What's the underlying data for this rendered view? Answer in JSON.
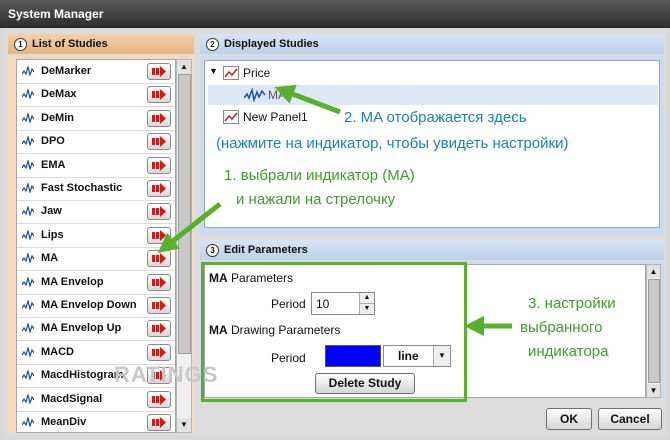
{
  "window": {
    "title": "System Manager"
  },
  "left": {
    "number": "1",
    "title": "List of Studies",
    "items": [
      "DeMarker",
      "DeMax",
      "DeMin",
      "DPO",
      "EMA",
      "Fast Stochastic",
      "Jaw",
      "Lips",
      "MA",
      "MA Envelop",
      "MA Envelop Down",
      "MA Envelop Up",
      "MACD",
      "MacdHistogram",
      "MacdSignal",
      "MeanDiv"
    ]
  },
  "displayed": {
    "number": "2",
    "title": "Displayed Studies",
    "price_label": "Price",
    "ma_label": "MA",
    "panel_label": "New Panel1"
  },
  "params": {
    "number": "3",
    "title": "Edit Parameters",
    "section1_prefix": "MA",
    "section1_label": "Parameters",
    "period_label": "Period",
    "period_value": "10",
    "section2_prefix": "MA",
    "section2_label": "Drawing Parameters",
    "draw_period_label": "Period",
    "line_color": "#0000ff",
    "line_style": "line",
    "delete_label": "Delete Study"
  },
  "footer": {
    "ok_label": "OK",
    "cancel_label": "Cancel"
  },
  "annotations": {
    "a1_line1": "1. выбрали индикатор (MA)",
    "a1_line2": "и нажали на стрелочку",
    "a2_line1": "2. MA отображается здесь",
    "a2_line2": "(нажмите на индикатор, чтобы увидеть настройки)",
    "a3_line1": "3. настройки",
    "a3_line2": "выбранного",
    "a3_line3": "индикатора"
  },
  "watermark": "RATINGS",
  "colors": {
    "arrow": "#58b12c",
    "add_icon": "#cc1c1c",
    "accent_blue": "#1b83b5"
  }
}
